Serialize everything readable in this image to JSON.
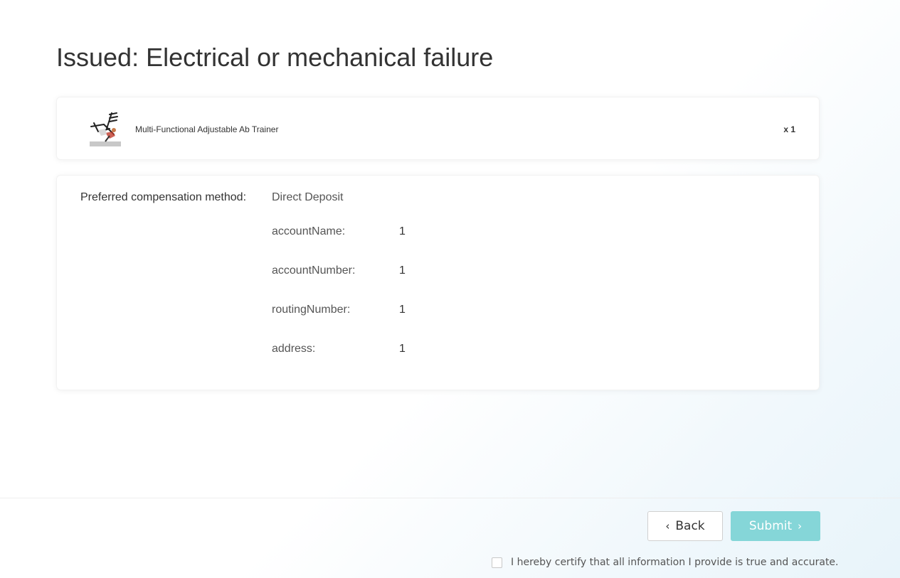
{
  "page": {
    "title": "Issued: Electrical or mechanical failure"
  },
  "product": {
    "name": "Multi-Functional Adjustable Ab Trainer",
    "quantity": "x 1",
    "thumbnail_icon": "ab-trainer-product-image"
  },
  "compensation": {
    "label": "Preferred compensation method:",
    "method": "Direct Deposit",
    "fields": [
      {
        "key": "accountName:",
        "value": "1"
      },
      {
        "key": "accountNumber:",
        "value": "1"
      },
      {
        "key": "routingNumber:",
        "value": "1"
      },
      {
        "key": "address:",
        "value": "1"
      }
    ]
  },
  "actions": {
    "back_label": "Back",
    "back_icon": "chevron-left-icon",
    "submit_label": "Submit",
    "submit_icon": "chevron-right-icon",
    "submit_color": "#85d6d8"
  },
  "certify": {
    "label": "I hereby certify that all information I provide is true and accurate.",
    "checked": false
  }
}
